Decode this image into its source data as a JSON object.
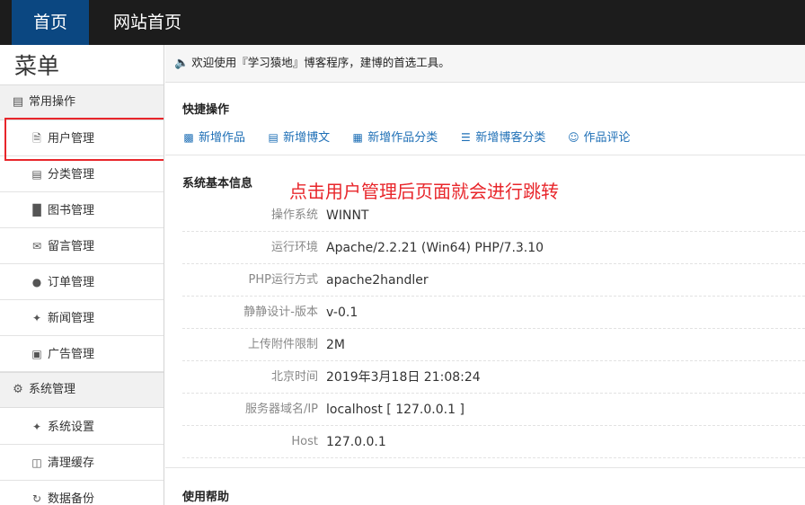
{
  "topnav": {
    "home": "首页",
    "site_home": "网站首页"
  },
  "sidebar": {
    "title": "菜单",
    "groups": [
      {
        "label": "常用操作",
        "icon": "list-box-icon",
        "items": [
          {
            "label": "用户管理",
            "icon": "file-icon"
          },
          {
            "label": "分类管理",
            "icon": "list-icon"
          },
          {
            "label": "图书管理",
            "icon": "books-icon"
          },
          {
            "label": "留言管理",
            "icon": "envelope-icon"
          },
          {
            "label": "订单管理",
            "icon": "comment-icon"
          },
          {
            "label": "新闻管理",
            "icon": "wrench-icon"
          },
          {
            "label": "广告管理",
            "icon": "picture-icon"
          }
        ]
      },
      {
        "label": "系统管理",
        "icon": "gear-icon",
        "items": [
          {
            "label": "系统设置",
            "icon": "wrench-icon"
          },
          {
            "label": "清理缓存",
            "icon": "trash-icon"
          },
          {
            "label": "数据备份",
            "icon": "refresh-icon"
          }
        ]
      }
    ]
  },
  "notice": {
    "icon": "speaker-icon",
    "text": "欢迎使用『学习猿地』博客程序，建博的首选工具。"
  },
  "quick": {
    "title": "快捷操作",
    "links": [
      {
        "label": "新增作品",
        "icon": "card-icon"
      },
      {
        "label": "新增博文",
        "icon": "document-icon"
      },
      {
        "label": "新增作品分类",
        "icon": "image-list-icon"
      },
      {
        "label": "新增博客分类",
        "icon": "menu-icon"
      },
      {
        "label": "作品评论",
        "icon": "face-icon"
      }
    ]
  },
  "sysinfo": {
    "title": "系统基本信息",
    "rows": [
      {
        "label": "操作系统",
        "value": "WINNT"
      },
      {
        "label": "运行环境",
        "value": "Apache/2.2.21 (Win64) PHP/7.3.10"
      },
      {
        "label": "PHP运行方式",
        "value": "apache2handler"
      },
      {
        "label": "静静设计-版本",
        "value": "v-0.1"
      },
      {
        "label": "上传附件限制",
        "value": "2M"
      },
      {
        "label": "北京时间",
        "value": "2019年3月18日 21:08:24"
      },
      {
        "label": "服务器域名/IP",
        "value": "localhost [ 127.0.0.1 ]"
      },
      {
        "label": "Host",
        "value": "127.0.0.1"
      }
    ]
  },
  "help": {
    "title": "使用帮助"
  },
  "annotation": "点击用户管理后页面就会进行跳转",
  "colors": {
    "accent": "#0b4781",
    "link": "#1e6fb6",
    "annotation": "#e8262b",
    "topbar": "#1c1c1c"
  }
}
